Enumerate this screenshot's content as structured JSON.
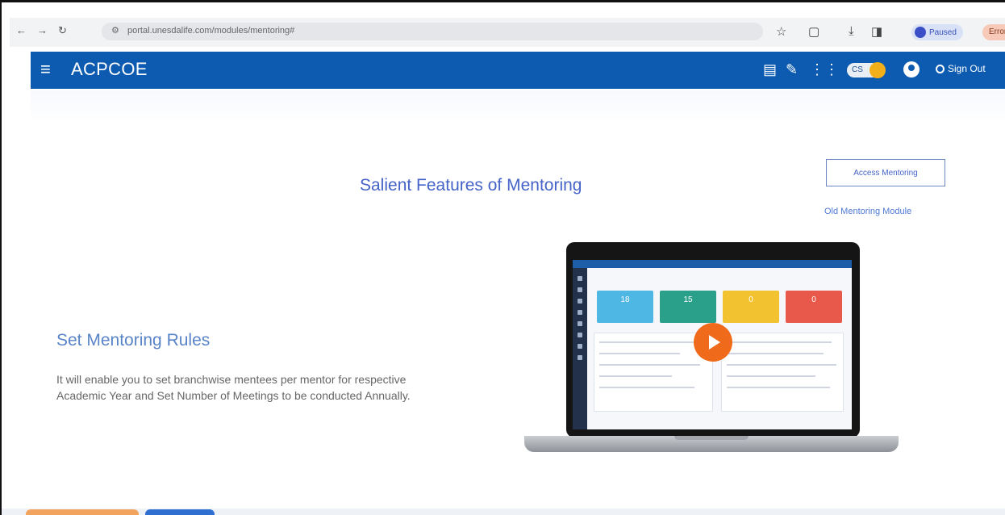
{
  "browser": {
    "back_icon": "back-arrow-icon",
    "forward_icon": "forward-arrow-icon",
    "reload_icon": "reload-icon",
    "site_info_icon": "site-info-icon",
    "url": "portal.unesdalife.com/modules/mentoring#",
    "bookmark_icon": "star-icon",
    "extensions_icon": "puzzle-icon",
    "download_icon": "download-icon",
    "sidepanel_icon": "side-panel-icon",
    "profile_label": "Paused",
    "error_label": "Error"
  },
  "app": {
    "title": "ACPCOE",
    "menu_icon": "hamburger-menu-icon",
    "header_icons": [
      "notes-icon",
      "rocket-icon",
      "apps-grid-icon"
    ],
    "cart_badge": "CS",
    "profile_icon": "user-account-icon",
    "signout_label": "Sign Out"
  },
  "main": {
    "heading": "Salient Features of Mentoring",
    "access_button": "Access Mentoring",
    "old_module_link": "Old Mentoring Module",
    "rule_title": "Set Mentoring Rules",
    "rule_text": "It will enable you to set branchwise mentees per mentor for respective Academic Year and Set Number of Meetings to be conducted Annually.",
    "video": {
      "play_icon": "play-icon",
      "tiles": [
        {
          "value": "18",
          "color": "#4fb7e3"
        },
        {
          "value": "15",
          "color": "#2aa08a"
        },
        {
          "value": "0",
          "color": "#f2c230"
        },
        {
          "value": "0",
          "color": "#e8584b"
        }
      ]
    }
  }
}
